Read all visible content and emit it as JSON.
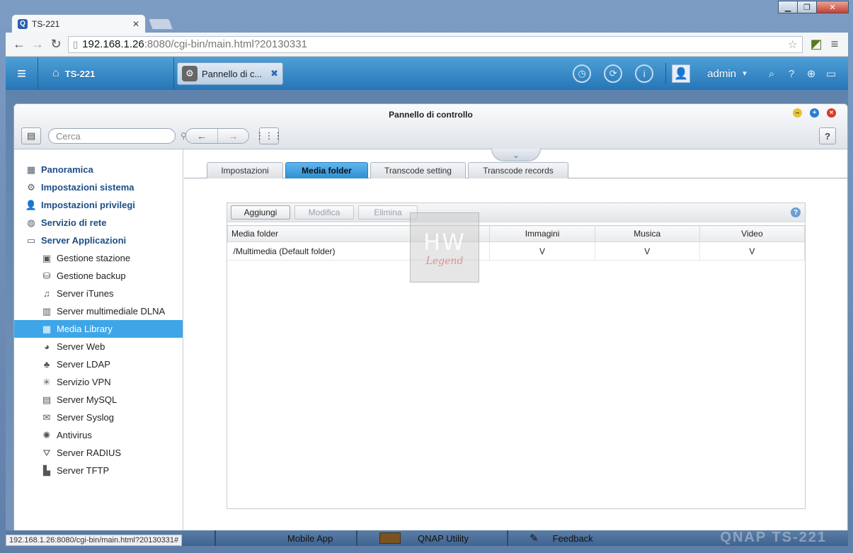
{
  "browser": {
    "tab_title": "TS-221",
    "favicon_letter": "Q",
    "url_host": "192.168.1.26",
    "url_rest": ":8080/cgi-bin/main.html?20130331",
    "status_url": "192.168.1.26:8080/cgi-bin/main.html?20130331#"
  },
  "qts": {
    "home_label": "TS-221",
    "app_tab_label": "Pannello di c...",
    "user": "admin"
  },
  "window": {
    "title": "Pannello di controllo",
    "search_placeholder": "Cerca"
  },
  "sidebar": {
    "items": [
      {
        "label": "Panoramica",
        "icon": "overview-icon",
        "level": "top"
      },
      {
        "label": "Impostazioni sistema",
        "icon": "gear-icon",
        "level": "top"
      },
      {
        "label": "Impostazioni privilegi",
        "icon": "user-icon",
        "level": "top"
      },
      {
        "label": "Servizio di rete",
        "icon": "network-icon",
        "level": "top"
      },
      {
        "label": "Server Applicazioni",
        "icon": "server-icon",
        "level": "top"
      },
      {
        "label": "Gestione stazione",
        "icon": "station-icon",
        "level": "sub"
      },
      {
        "label": "Gestione backup",
        "icon": "backup-icon",
        "level": "sub"
      },
      {
        "label": "Server iTunes",
        "icon": "itunes-icon",
        "level": "sub"
      },
      {
        "label": "Server multimediale DLNA",
        "icon": "dlna-icon",
        "level": "sub"
      },
      {
        "label": "Media Library",
        "icon": "media-library-icon",
        "level": "sub",
        "selected": true
      },
      {
        "label": "Server Web",
        "icon": "globe-icon",
        "level": "sub"
      },
      {
        "label": "Server LDAP",
        "icon": "ldap-icon",
        "level": "sub"
      },
      {
        "label": "Servizio VPN",
        "icon": "vpn-icon",
        "level": "sub"
      },
      {
        "label": "Server MySQL",
        "icon": "database-icon",
        "level": "sub"
      },
      {
        "label": "Server Syslog",
        "icon": "syslog-icon",
        "level": "sub"
      },
      {
        "label": "Antivirus",
        "icon": "antivirus-icon",
        "level": "sub"
      },
      {
        "label": "Server RADIUS",
        "icon": "radius-icon",
        "level": "sub"
      },
      {
        "label": "Server TFTP",
        "icon": "tftp-icon",
        "level": "sub"
      }
    ]
  },
  "tabs": [
    "Impostazioni",
    "Media folder",
    "Transcode setting",
    "Transcode records"
  ],
  "selected_tab": "Media folder",
  "toolbar": {
    "add": "Aggiungi",
    "edit": "Modifica",
    "delete": "Elimina"
  },
  "table": {
    "columns": [
      "Media folder",
      "Immagini",
      "Musica",
      "Video"
    ],
    "rows": [
      [
        "/Multimedia (Default folder)",
        "V",
        "V",
        "V"
      ]
    ]
  },
  "watermark": {
    "main": "HW",
    "sub": "Legend"
  },
  "dock": {
    "items": [
      "Mobile App",
      "QNAP Utility",
      "Feedback"
    ],
    "brand": "QNAP TS-221"
  }
}
